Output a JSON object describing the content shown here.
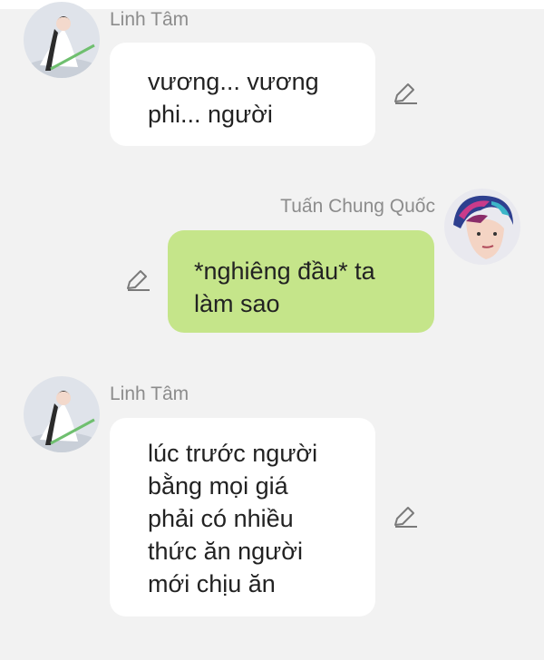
{
  "chat": {
    "messages": [
      {
        "sender": "Linh Tâm",
        "side": "left",
        "lines": [
          "vương... vương",
          "phi... người"
        ]
      },
      {
        "sender": "Tuấn Chung Quốc",
        "side": "right",
        "lines": [
          "*nghiêng đầu* ta",
          "làm sao"
        ]
      },
      {
        "sender": "Linh Tâm",
        "side": "left",
        "lines": [
          "lúc trước người",
          "bằng mọi giá",
          "phải có nhiều",
          "thức ăn người",
          "mới chịu ăn"
        ]
      }
    ]
  },
  "icons": {
    "edit": "pencil-edit-icon",
    "avatar_left": "girl-in-white-avatar",
    "avatar_right": "boy-colorful-avatar"
  },
  "colors": {
    "background": "#f2f2f2",
    "bubble_left": "#ffffff",
    "bubble_right": "#c5e58a",
    "name_text": "#8c8c8c",
    "message_text": "#222222"
  }
}
